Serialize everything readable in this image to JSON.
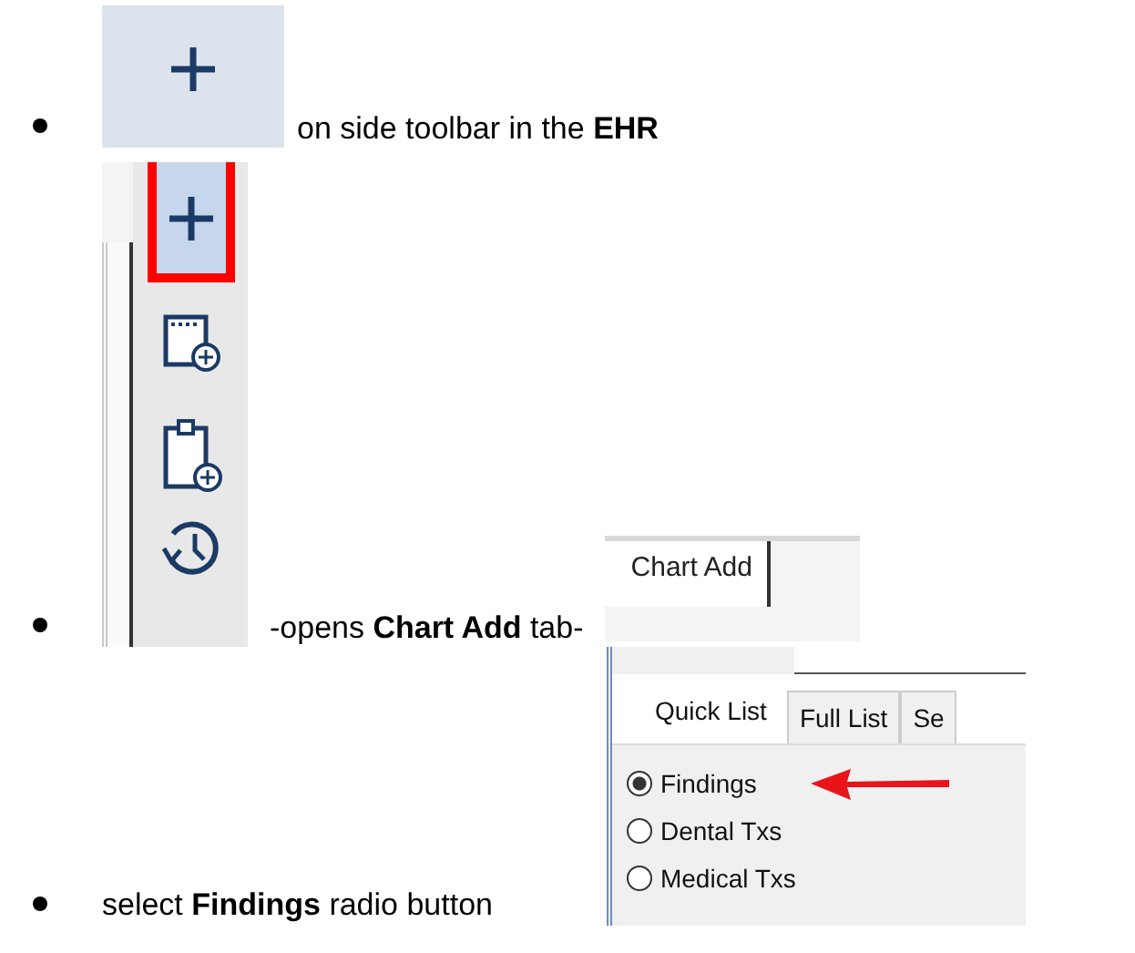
{
  "items": [
    {
      "text": "on side toolbar in the **EHR**"
    },
    {
      "text": "-opens  **Chart Add** tab-"
    },
    {
      "text": "select **Findings** radio button"
    }
  ],
  "toolbar": {
    "buttons": [
      {
        "kind": "add",
        "selected": true
      },
      {
        "kind": "calendar-add",
        "selected": false
      },
      {
        "kind": "clipboard-add",
        "selected": false
      },
      {
        "kind": "history",
        "selected": false
      }
    ]
  },
  "tab_snippet": {
    "label": "Chart Add"
  },
  "panel": {
    "tabs": [
      {
        "label": "Quick List",
        "selected": true
      },
      {
        "label": "Full List",
        "selected": false
      },
      {
        "label": "Se",
        "selected": false
      }
    ],
    "radios": [
      {
        "label": "Findings",
        "selected": true
      },
      {
        "label": "Dental Txs",
        "selected": false
      },
      {
        "label": "Medical Txs",
        "selected": false
      }
    ]
  }
}
